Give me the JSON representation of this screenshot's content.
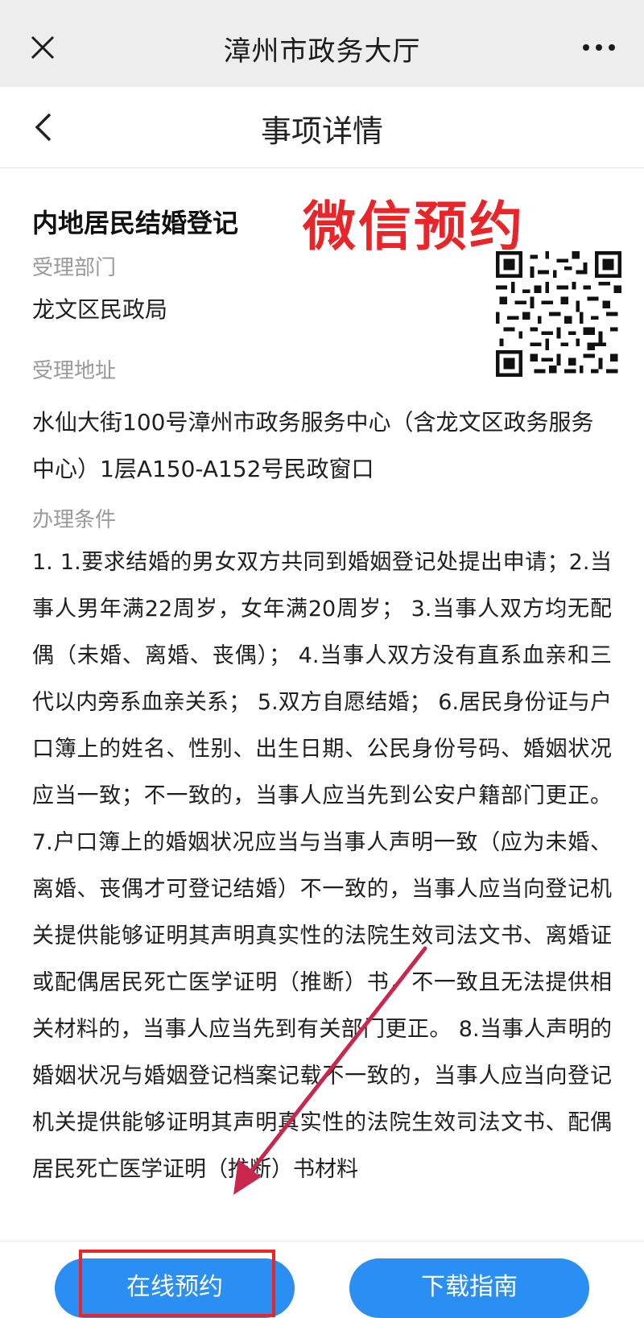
{
  "window": {
    "title": "漳州市政务大厅"
  },
  "header": {
    "title": "事项详情"
  },
  "annotation": {
    "wechat_label": "微信预约",
    "color": "#e8262a"
  },
  "item": {
    "title": "内地居民结婚登记",
    "department_label": "受理部门",
    "department": "龙文区民政局",
    "address_label": "受理地址",
    "address": "水仙大街100号漳州市政务服务中心（含龙文区政务服务中心）1层A150-A152号民政窗口",
    "conditions_label": "办理条件",
    "conditions": "1. 1.要求结婚的男女双方共同到婚姻登记处提出申请；2.当事人男年满22周岁，女年满20周岁； 3.当事人双方均无配偶（未婚、离婚、丧偶）； 4.当事人双方没有直系血亲和三代以内旁系血亲关系； 5.双方自愿结婚； 6.居民身份证与户口簿上的姓名、性别、出生日期、公民身份号码、婚姻状况应当一致；不一致的，当事人应当先到公安户籍部门更正。 7.户口簿上的婚姻状况应当与当事人声明一致（应为未婚、离婚、丧偶才可登记结婚）不一致的，当事人应当向登记机关提供能够证明其声明真实性的法院生效司法文书、离婚证或配偶居民死亡医学证明（推断）书，不一致且无法提供相关材料的，当事人应当先到有关部门更正。 8.当事人声明的婚姻状况与婚姻登记档案记载不一致的，当事人应当向登记机关提供能够证明其声明真实性的法院生效司法文书、配偶居民死亡医学证明（推断）书材料"
  },
  "buttons": {
    "online": "在线预约",
    "guide": "下载指南"
  },
  "colors": {
    "primary": "#2b8ef2",
    "accent": "#e8262a",
    "topbar": "#ededed"
  },
  "icons": {
    "close": "close-icon",
    "more": "more-icon",
    "back": "back-icon",
    "qr": "qr-code"
  }
}
